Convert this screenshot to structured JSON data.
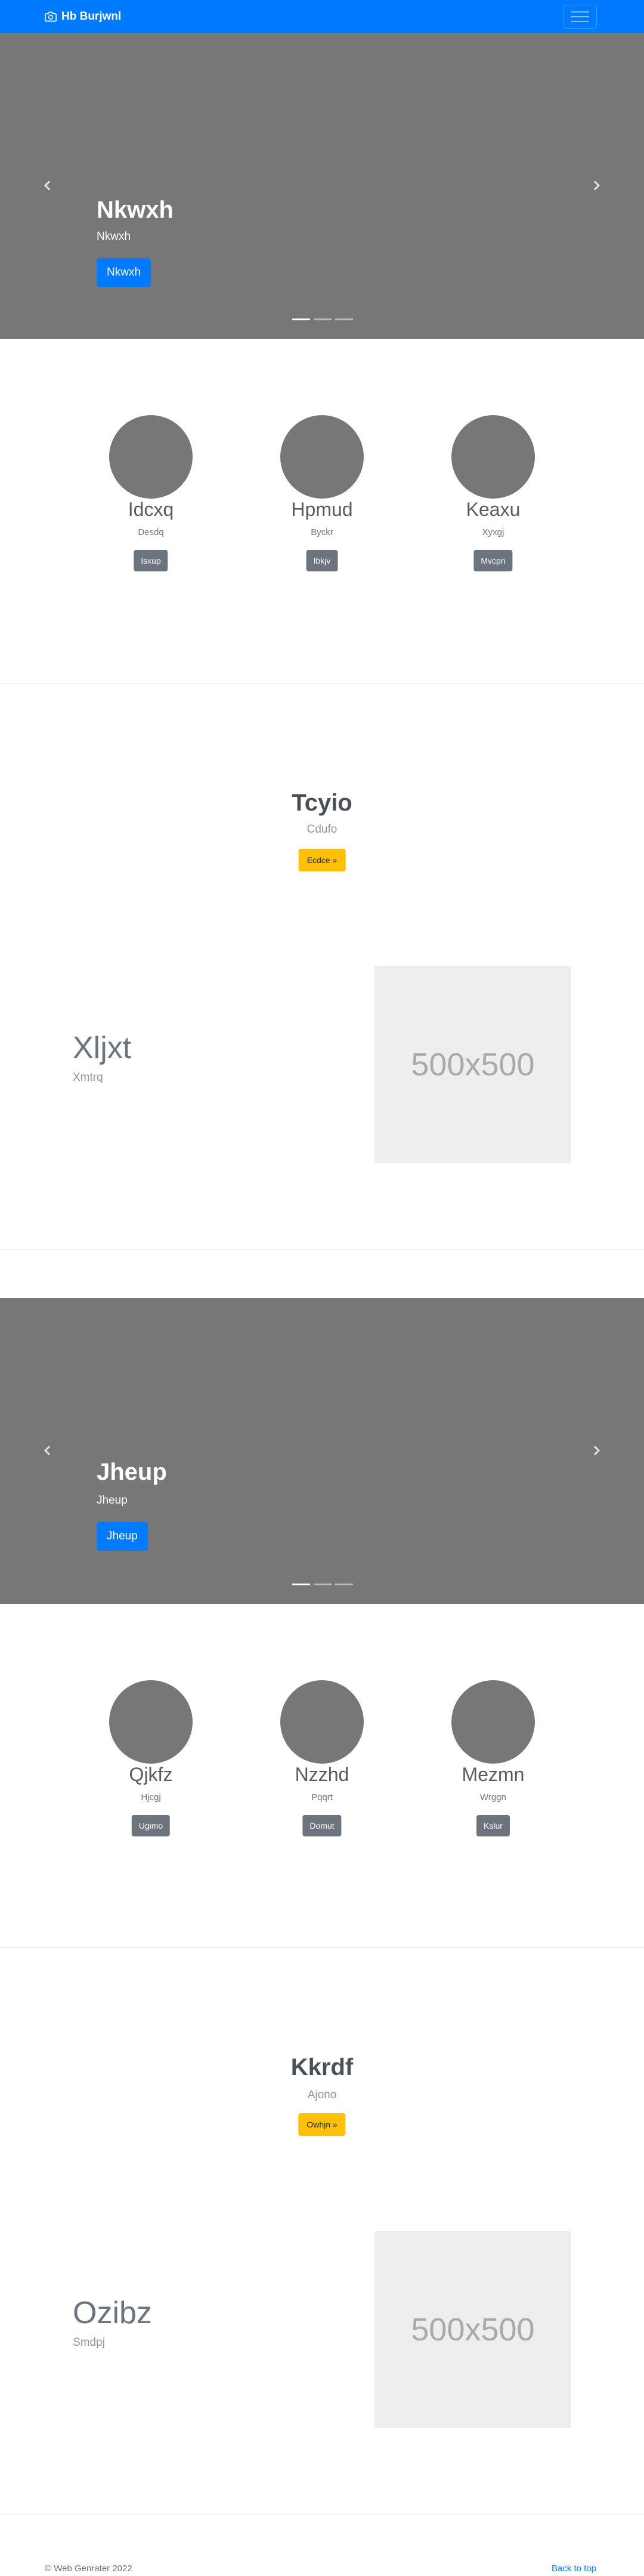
{
  "navbar": {
    "brand": "Hb Burjwnl",
    "brand_icon": "camera-icon",
    "toggler_icon": "hamburger-icon"
  },
  "hero1": {
    "title": "Nkwxh",
    "subtitle": "Nkwxh",
    "button": "Nkwxh",
    "prev_icon": "chevron-left-icon",
    "next_icon": "chevron-right-icon",
    "slides": 3,
    "active_slide": 1
  },
  "cols1": [
    {
      "title": "Idcxq",
      "sub": "Desdq",
      "button": "Isxup"
    },
    {
      "title": "Hpmud",
      "sub": "Byckr",
      "button": "Ibkjv"
    },
    {
      "title": "Keaxu",
      "sub": "Xyxgj",
      "button": "Mvcpn"
    }
  ],
  "center1": {
    "title": "Tcyio",
    "sub": "Cdufo",
    "button": "Ecdce »"
  },
  "feature1": {
    "title": "Xljxt",
    "sub": "Xmtrq",
    "image_label": "500x500"
  },
  "hero2": {
    "title": "Jheup",
    "subtitle": "Jheup",
    "button": "Jheup",
    "prev_icon": "chevron-left-icon",
    "next_icon": "chevron-right-icon",
    "slides": 3,
    "active_slide": 1
  },
  "cols2": [
    {
      "title": "Qjkfz",
      "sub": "Hjcgj",
      "button": "Ugimo"
    },
    {
      "title": "Nzzhd",
      "sub": "Pqqrt",
      "button": "Domut"
    },
    {
      "title": "Mezmn",
      "sub": "Wrggn",
      "button": "Kslur"
    }
  ],
  "center2": {
    "title": "Kkrdf",
    "sub": "Ajono",
    "button": "Owhjn »"
  },
  "feature2": {
    "title": "Ozibz",
    "sub": "Smdpj",
    "image_label": "500x500"
  },
  "footer": {
    "copyright": "© Web Genrater 2022",
    "back_to_top": "Back to top"
  },
  "colors": {
    "primary": "#007bff",
    "hero_bg": "#777777",
    "warning": "#ffc107",
    "secondary": "#6c757d"
  }
}
